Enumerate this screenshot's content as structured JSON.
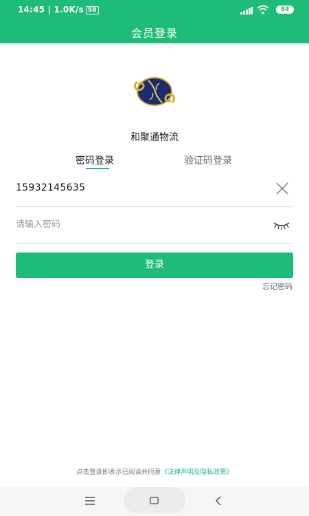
{
  "status_bar": {
    "time": "14:45 | 1.0K/s",
    "sim_badge": "58",
    "battery": "84",
    "icons": [
      "signal-icon",
      "wifi-icon",
      "battery-icon"
    ]
  },
  "header": {
    "title": "会员登录"
  },
  "brand": {
    "logo_icon": "company-logo",
    "name": "和聚通物流"
  },
  "tabs": [
    {
      "label": "密码登录",
      "active": true
    },
    {
      "label": "验证码登录",
      "active": false
    }
  ],
  "form": {
    "phone_value": "15932145635",
    "password_placeholder": "请输入密码",
    "password_value": "",
    "clear_icon": "close-icon",
    "visibility_icon": "eye-closed-icon"
  },
  "actions": {
    "login_label": "登录",
    "forgot_label": "忘记密码"
  },
  "agreement": {
    "text": "点击登录即表示已阅读并同意",
    "link": "《法律声明及隐私政策》"
  },
  "navbar": {
    "icons": [
      "menu-icon",
      "home-icon",
      "back-icon"
    ]
  },
  "colors": {
    "accent": "#1fbb78",
    "divider": "#d4d4d4",
    "text": "#222222",
    "muted": "#9a9a9a"
  }
}
